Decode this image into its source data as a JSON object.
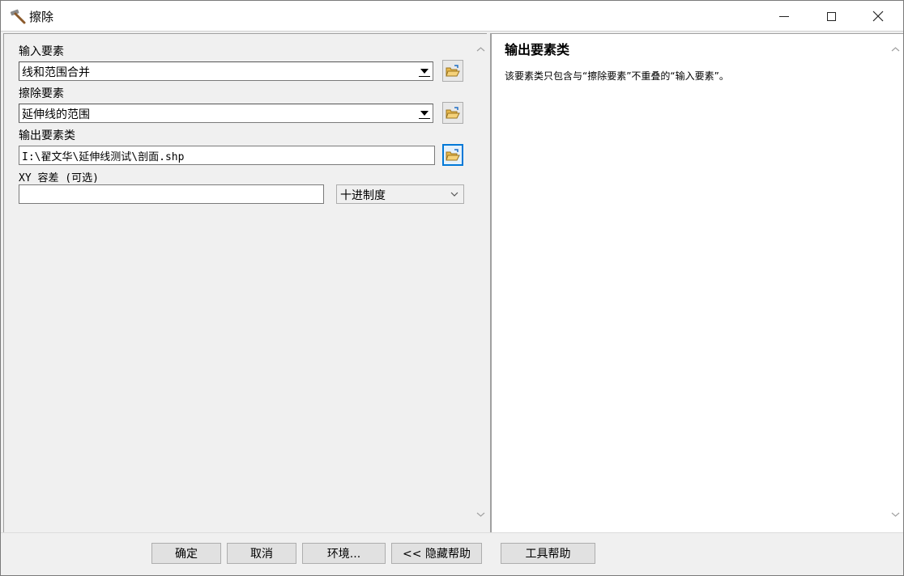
{
  "window": {
    "title": "擦除",
    "icon": "hammer-icon"
  },
  "form": {
    "input_features": {
      "label": "输入要素",
      "value": "线和范围合并"
    },
    "erase_features": {
      "label": "擦除要素",
      "value": "延伸线的范围"
    },
    "output_feature_class": {
      "label": "输出要素类",
      "value": "I:\\翟文华\\延伸线测试\\剖面.shp"
    },
    "xy_tolerance": {
      "label": "XY 容差 (可选)",
      "value": "",
      "unit": "十进制度"
    }
  },
  "help": {
    "title": "输出要素类",
    "text": "该要素类只包含与“擦除要素”不重叠的“输入要素”。"
  },
  "buttons": {
    "ok": "确定",
    "cancel": "取消",
    "environments": "环境...",
    "hide_help": "<< 隐藏帮助",
    "tool_help": "工具帮助"
  },
  "colors": {
    "accent": "#0078d7",
    "folder": "#e8b84a"
  }
}
